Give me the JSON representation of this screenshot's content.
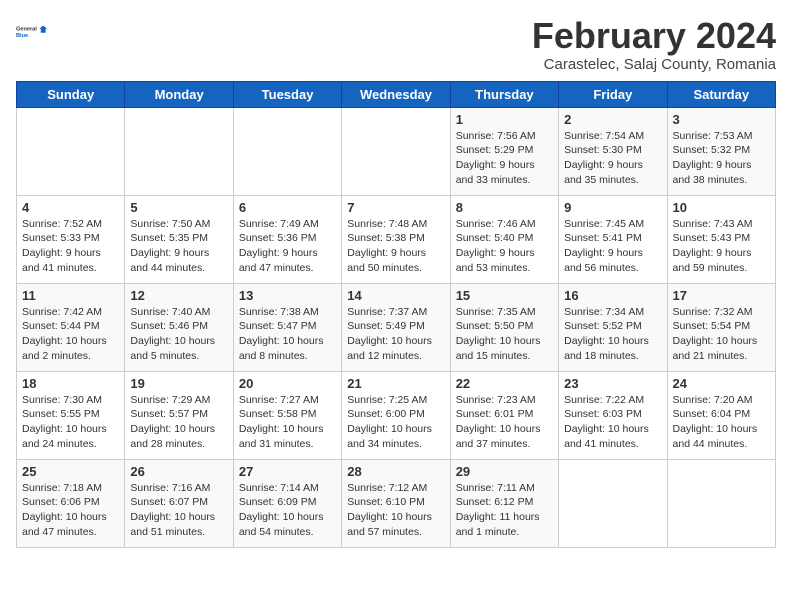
{
  "logo": {
    "text_general": "General",
    "text_blue": "Blue"
  },
  "header": {
    "title": "February 2024",
    "subtitle": "Carastelec, Salaj County, Romania"
  },
  "weekdays": [
    "Sunday",
    "Monday",
    "Tuesday",
    "Wednesday",
    "Thursday",
    "Friday",
    "Saturday"
  ],
  "weeks": [
    [
      {
        "day": "",
        "info": ""
      },
      {
        "day": "",
        "info": ""
      },
      {
        "day": "",
        "info": ""
      },
      {
        "day": "",
        "info": ""
      },
      {
        "day": "1",
        "info": "Sunrise: 7:56 AM\nSunset: 5:29 PM\nDaylight: 9 hours\nand 33 minutes."
      },
      {
        "day": "2",
        "info": "Sunrise: 7:54 AM\nSunset: 5:30 PM\nDaylight: 9 hours\nand 35 minutes."
      },
      {
        "day": "3",
        "info": "Sunrise: 7:53 AM\nSunset: 5:32 PM\nDaylight: 9 hours\nand 38 minutes."
      }
    ],
    [
      {
        "day": "4",
        "info": "Sunrise: 7:52 AM\nSunset: 5:33 PM\nDaylight: 9 hours\nand 41 minutes."
      },
      {
        "day": "5",
        "info": "Sunrise: 7:50 AM\nSunset: 5:35 PM\nDaylight: 9 hours\nand 44 minutes."
      },
      {
        "day": "6",
        "info": "Sunrise: 7:49 AM\nSunset: 5:36 PM\nDaylight: 9 hours\nand 47 minutes."
      },
      {
        "day": "7",
        "info": "Sunrise: 7:48 AM\nSunset: 5:38 PM\nDaylight: 9 hours\nand 50 minutes."
      },
      {
        "day": "8",
        "info": "Sunrise: 7:46 AM\nSunset: 5:40 PM\nDaylight: 9 hours\nand 53 minutes."
      },
      {
        "day": "9",
        "info": "Sunrise: 7:45 AM\nSunset: 5:41 PM\nDaylight: 9 hours\nand 56 minutes."
      },
      {
        "day": "10",
        "info": "Sunrise: 7:43 AM\nSunset: 5:43 PM\nDaylight: 9 hours\nand 59 minutes."
      }
    ],
    [
      {
        "day": "11",
        "info": "Sunrise: 7:42 AM\nSunset: 5:44 PM\nDaylight: 10 hours\nand 2 minutes."
      },
      {
        "day": "12",
        "info": "Sunrise: 7:40 AM\nSunset: 5:46 PM\nDaylight: 10 hours\nand 5 minutes."
      },
      {
        "day": "13",
        "info": "Sunrise: 7:38 AM\nSunset: 5:47 PM\nDaylight: 10 hours\nand 8 minutes."
      },
      {
        "day": "14",
        "info": "Sunrise: 7:37 AM\nSunset: 5:49 PM\nDaylight: 10 hours\nand 12 minutes."
      },
      {
        "day": "15",
        "info": "Sunrise: 7:35 AM\nSunset: 5:50 PM\nDaylight: 10 hours\nand 15 minutes."
      },
      {
        "day": "16",
        "info": "Sunrise: 7:34 AM\nSunset: 5:52 PM\nDaylight: 10 hours\nand 18 minutes."
      },
      {
        "day": "17",
        "info": "Sunrise: 7:32 AM\nSunset: 5:54 PM\nDaylight: 10 hours\nand 21 minutes."
      }
    ],
    [
      {
        "day": "18",
        "info": "Sunrise: 7:30 AM\nSunset: 5:55 PM\nDaylight: 10 hours\nand 24 minutes."
      },
      {
        "day": "19",
        "info": "Sunrise: 7:29 AM\nSunset: 5:57 PM\nDaylight: 10 hours\nand 28 minutes."
      },
      {
        "day": "20",
        "info": "Sunrise: 7:27 AM\nSunset: 5:58 PM\nDaylight: 10 hours\nand 31 minutes."
      },
      {
        "day": "21",
        "info": "Sunrise: 7:25 AM\nSunset: 6:00 PM\nDaylight: 10 hours\nand 34 minutes."
      },
      {
        "day": "22",
        "info": "Sunrise: 7:23 AM\nSunset: 6:01 PM\nDaylight: 10 hours\nand 37 minutes."
      },
      {
        "day": "23",
        "info": "Sunrise: 7:22 AM\nSunset: 6:03 PM\nDaylight: 10 hours\nand 41 minutes."
      },
      {
        "day": "24",
        "info": "Sunrise: 7:20 AM\nSunset: 6:04 PM\nDaylight: 10 hours\nand 44 minutes."
      }
    ],
    [
      {
        "day": "25",
        "info": "Sunrise: 7:18 AM\nSunset: 6:06 PM\nDaylight: 10 hours\nand 47 minutes."
      },
      {
        "day": "26",
        "info": "Sunrise: 7:16 AM\nSunset: 6:07 PM\nDaylight: 10 hours\nand 51 minutes."
      },
      {
        "day": "27",
        "info": "Sunrise: 7:14 AM\nSunset: 6:09 PM\nDaylight: 10 hours\nand 54 minutes."
      },
      {
        "day": "28",
        "info": "Sunrise: 7:12 AM\nSunset: 6:10 PM\nDaylight: 10 hours\nand 57 minutes."
      },
      {
        "day": "29",
        "info": "Sunrise: 7:11 AM\nSunset: 6:12 PM\nDaylight: 11 hours\nand 1 minute."
      },
      {
        "day": "",
        "info": ""
      },
      {
        "day": "",
        "info": ""
      }
    ]
  ]
}
